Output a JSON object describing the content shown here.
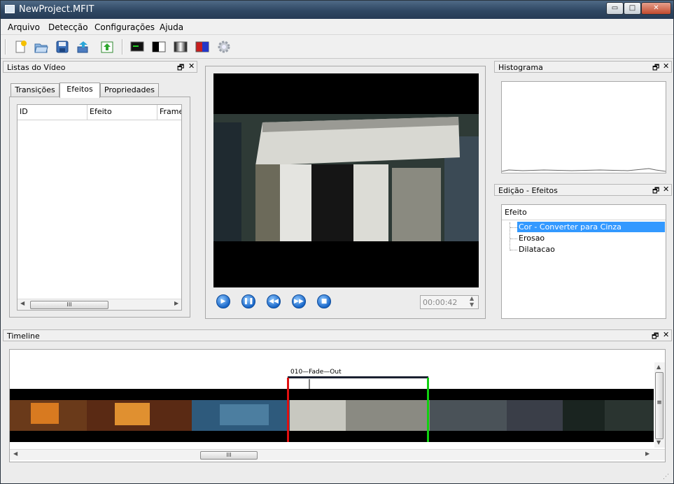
{
  "window": {
    "title": "NewProject.MFIT",
    "min": "▭",
    "max": "□",
    "close": "✕"
  },
  "menu": [
    "Arquivo",
    "Detecção",
    "Configurações",
    "Ajuda"
  ],
  "toolbar": {
    "icons": [
      "new-file-icon",
      "open-folder-icon",
      "save-icon",
      "import-icon",
      "export-icon",
      "monitor-icon",
      "black-white-icon",
      "gradient-icon",
      "color-icon",
      "gear-icon"
    ]
  },
  "video_list_panel": {
    "title": "Listas do Vídeo",
    "tabs": [
      "Transições",
      "Efeitos",
      "Propriedades"
    ],
    "active_tab": "Efeitos",
    "columns": [
      "ID",
      "Efeito",
      "Frame"
    ],
    "scroll_grip": "III"
  },
  "player": {
    "time": "00:00:42",
    "buttons": [
      "play",
      "pause",
      "rewind",
      "fast-forward",
      "stop"
    ]
  },
  "histogram_panel": {
    "title": "Histograma"
  },
  "effects_panel": {
    "title": "Edição - Efeitos",
    "header": "Efeito",
    "items": [
      "Cor - Converter para Cinza",
      "Erosao",
      "Dilatacao"
    ],
    "selected": "Cor - Converter para Cinza"
  },
  "timeline_panel": {
    "title": "Timeline",
    "segment_label": "010—Fade—Out",
    "scroll_grip": "III",
    "vscroll_grip": "≡"
  },
  "dock_buttons": {
    "float": "🗗",
    "close": "✕"
  },
  "colors": {
    "accent": "#3399ff",
    "marker_in": "#e01010",
    "marker_out": "#10d010"
  }
}
